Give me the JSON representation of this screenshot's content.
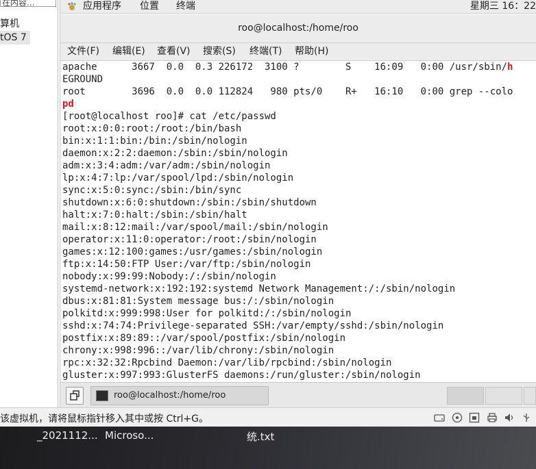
{
  "left_panel": {
    "search_placeholder": "在内容...",
    "tree_item_1": "算机",
    "tree_item_2": "tOS 7"
  },
  "topbar": {
    "apps": "应用程序",
    "places": "位置",
    "system": "终端",
    "clock": "星期三 16：22"
  },
  "terminal": {
    "title": "roo@localhost:/home/roo",
    "menu": [
      "文件(F)",
      "编辑(E)",
      "查看(V)",
      "搜索(S)",
      "终端(T)",
      "帮助(H)"
    ],
    "lines": [
      "apache      3667  0.0  0.3 226172  3100 ?        S    16:09   0:00 /usr/sbin/",
      "EGROUND",
      "root        3696  0.0  0.0 112824   980 pts/0    R+   16:10   0:00 grep --colo",
      "",
      "[root@localhost roo]# cat /etc/passwd",
      "root:x:0:0:root:/root:/bin/bash",
      "bin:x:1:1:bin:/bin:/sbin/nologin",
      "daemon:x:2:2:daemon:/sbin:/sbin/nologin",
      "adm:x:3:4:adm:/var/adm:/sbin/nologin",
      "lp:x:4:7:lp:/var/spool/lpd:/sbin/nologin",
      "sync:x:5:0:sync:/sbin:/bin/sync",
      "shutdown:x:6:0:shutdown:/sbin:/sbin/shutdown",
      "halt:x:7:0:halt:/sbin:/sbin/halt",
      "mail:x:8:12:mail:/var/spool/mail:/sbin/nologin",
      "operator:x:11:0:operator:/root:/sbin/nologin",
      "games:x:12:100:games:/usr/games:/sbin/nologin",
      "ftp:x:14:50:FTP User:/var/ftp:/sbin/nologin",
      "nobody:x:99:99:Nobody:/:/sbin/nologin",
      "systemd-network:x:192:192:systemd Network Management:/:/sbin/nologin",
      "dbus:x:81:81:System message bus:/:/sbin/nologin",
      "polkitd:x:999:998:User for polkitd:/:/sbin/nologin",
      "sshd:x:74:74:Privilege-separated SSH:/var/empty/sshd:/sbin/nologin",
      "postfix:x:89:89::/var/spool/postfix:/sbin/nologin",
      "chrony:x:998:996::/var/lib/chrony:/sbin/nologin",
      "rpc:x:32:32:Rpcbind Daemon:/var/lib/rpcbind:/sbin/nologin",
      "gluster:x:997:993:GlusterFS daemons:/run/gluster:/sbin/nologin"
    ],
    "highlight_line1": "h",
    "highlight_line4": "pd"
  },
  "taskbar": {
    "task_label": "roo@localhost:/home/roo"
  },
  "vm_status": {
    "text": "该虚拟机，请将鼠标指针移入其中或按 Ctrl+G。"
  },
  "host_desktop": {
    "label_1": "_2021112...",
    "label_2": "Microso...",
    "label_3": "统.txt"
  },
  "colors": {
    "grep_highlight": "#e0161f",
    "panel_bg": "#ececec"
  }
}
